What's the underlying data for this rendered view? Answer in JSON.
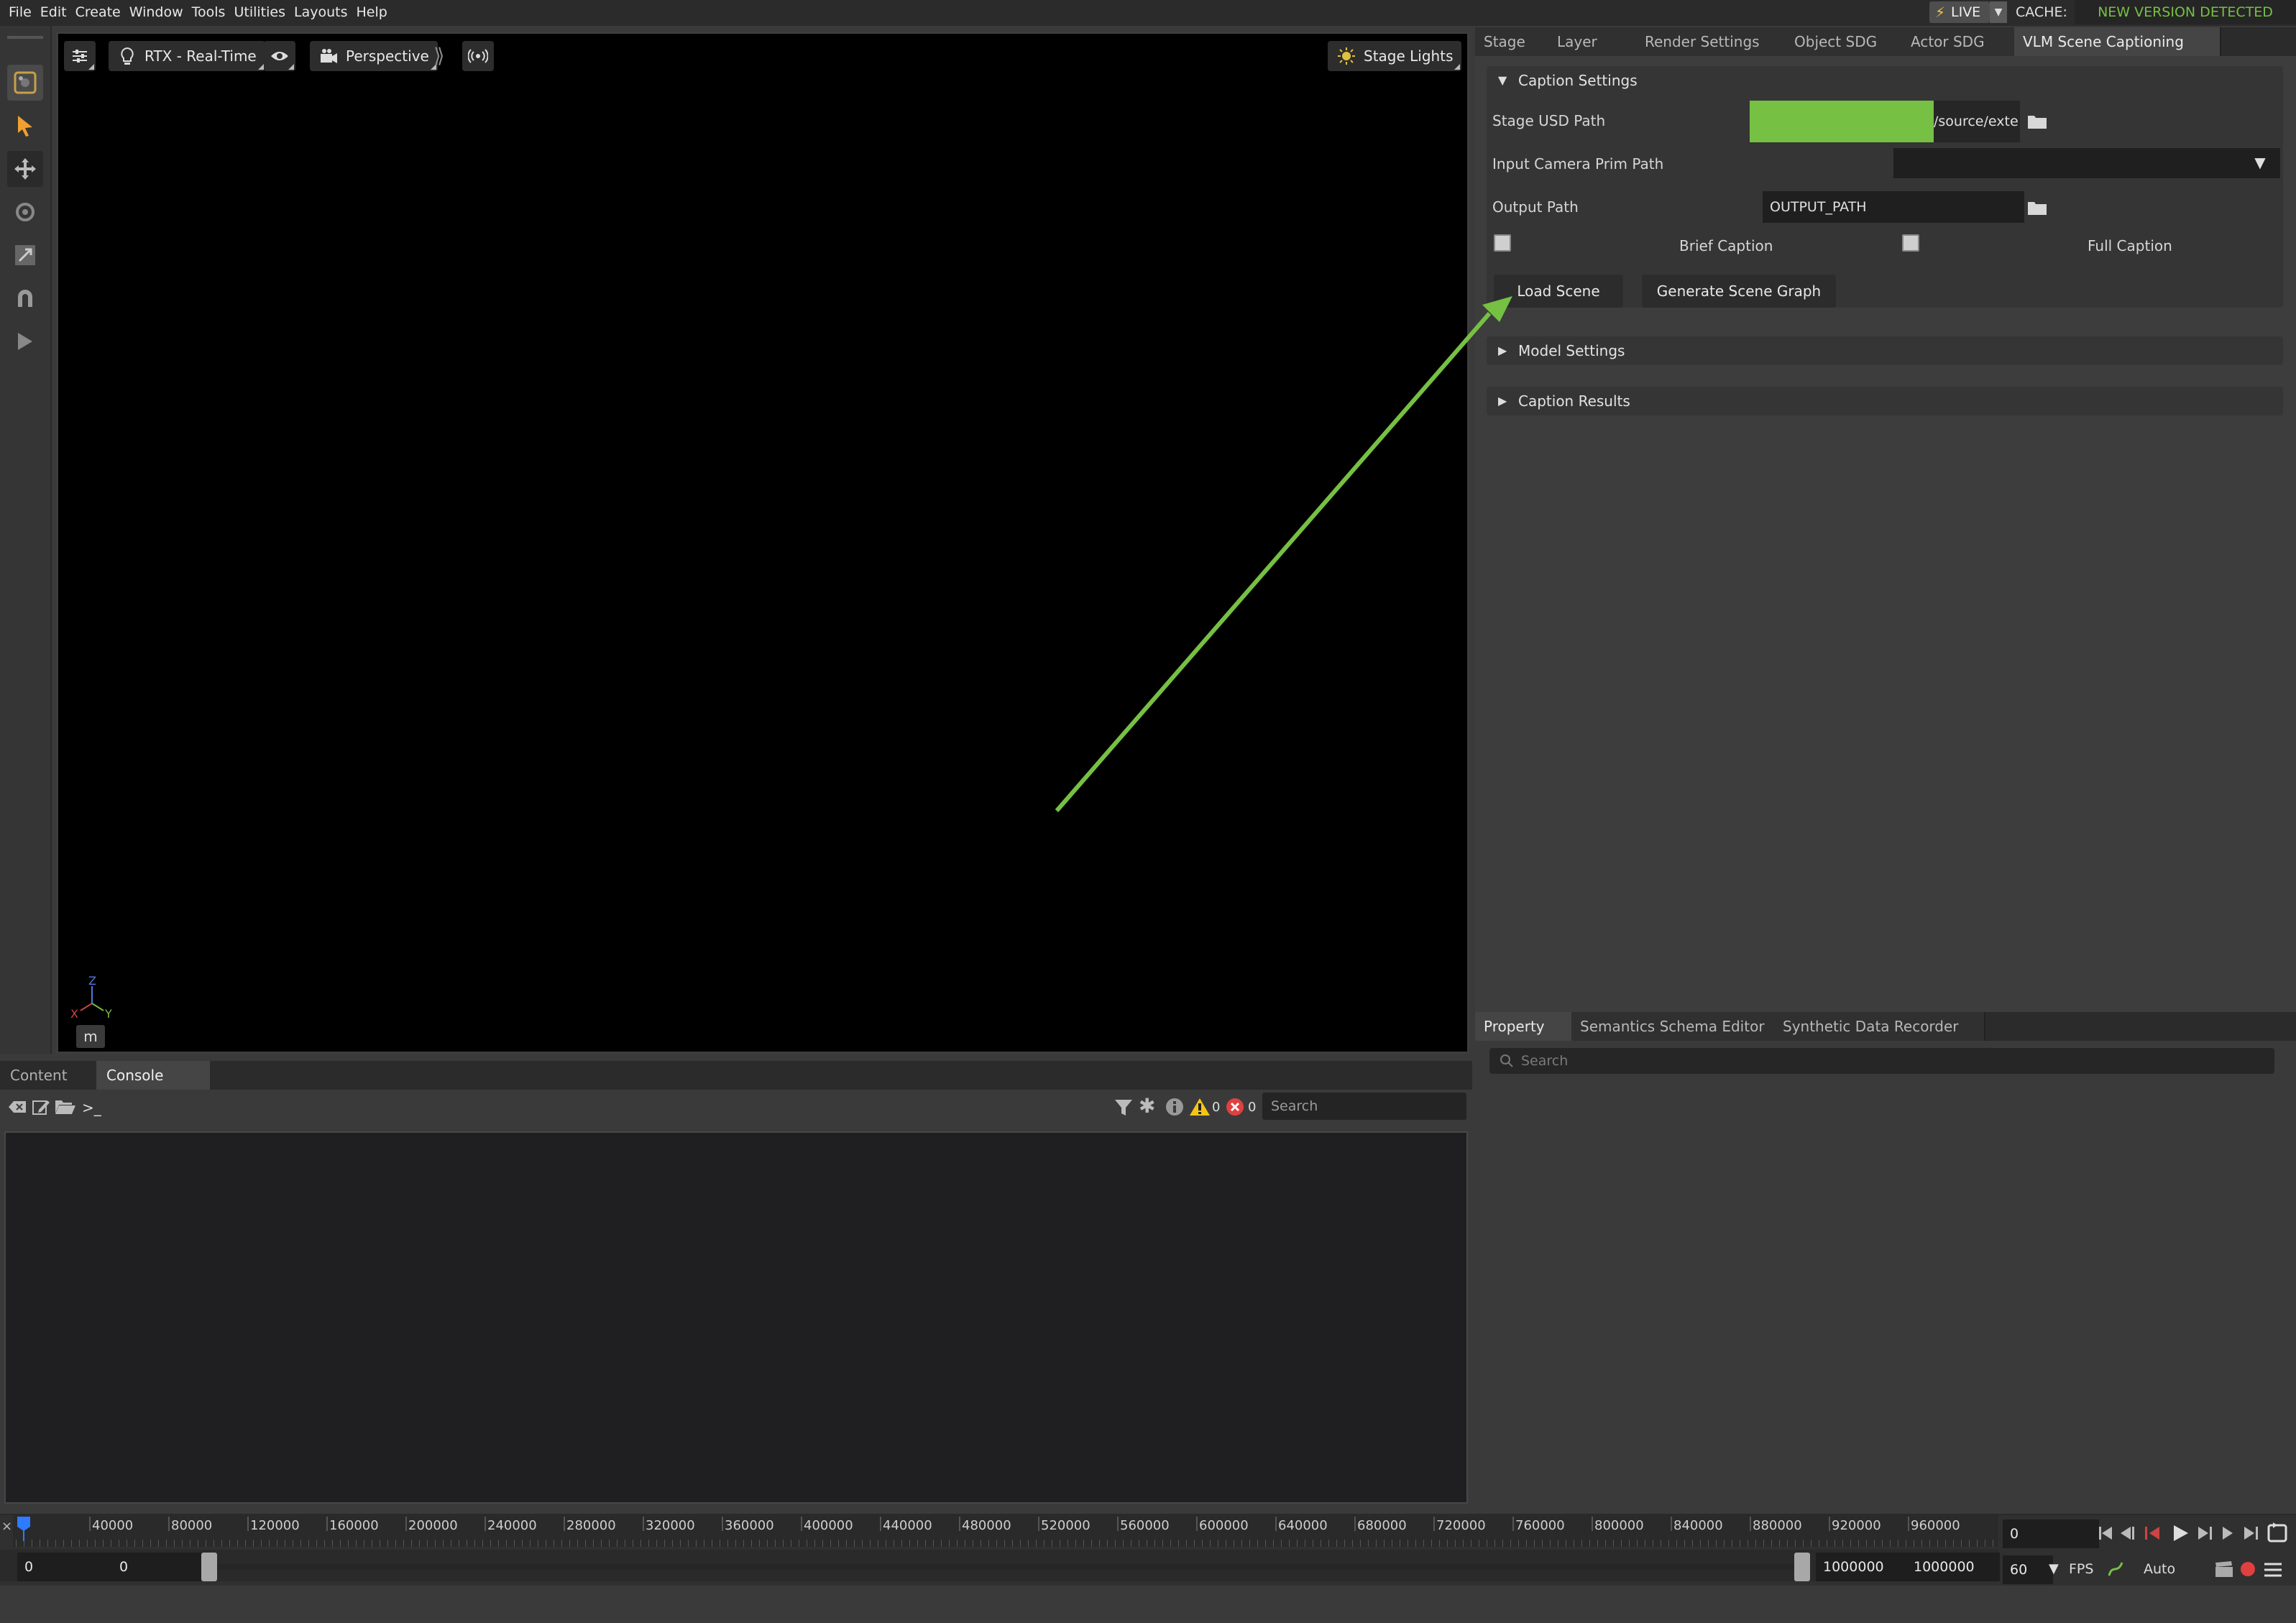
{
  "menu": {
    "items": [
      "File",
      "Edit",
      "Create",
      "Window",
      "Tools",
      "Utilities",
      "Layouts",
      "Help"
    ]
  },
  "header": {
    "live_label": "LIVE",
    "cache_label": "CACHE:",
    "cache_status": "NEW VERSION DETECTED"
  },
  "toolbar": {
    "tools": [
      "viewport-settings-icon",
      "select-icon",
      "move-icon",
      "rotate-icon",
      "scale-icon",
      "snap-icon",
      "play-icon"
    ]
  },
  "viewport": {
    "renderer_label": "RTX - Real-Time",
    "camera_label": "Perspective",
    "lights_label": "Stage Lights",
    "axis": {
      "z": "Z",
      "x": "X",
      "y": "Y"
    },
    "unit": "m"
  },
  "right_tabs": [
    "Stage",
    "Layer",
    "Render Settings",
    "Object SDG",
    "Actor SDG",
    "VLM Scene Captioning"
  ],
  "caption_settings": {
    "title": "Caption Settings",
    "stage_usd_label": "Stage USD Path",
    "stage_usd_value": "/source/exte",
    "camera_label": "Input Camera Prim Path",
    "camera_value": "",
    "output_label": "Output Path",
    "output_value": "OUTPUT_PATH",
    "brief_caption_label": "Brief Caption",
    "full_caption_label": "Full Caption",
    "load_scene_button": "Load Scene",
    "generate_graph_button": "Generate Scene Graph"
  },
  "model_settings": {
    "title": "Model Settings"
  },
  "caption_results": {
    "title": "Caption Results"
  },
  "property_tabs": [
    "Property",
    "Semantics Schema Editor",
    "Synthetic Data Recorder"
  ],
  "property": {
    "search_placeholder": "Search"
  },
  "bottom_tabs": [
    "Content",
    "Console"
  ],
  "console": {
    "warning_count": "0",
    "error_count": "0",
    "search_placeholder": "Search"
  },
  "timeline": {
    "ticks": [
      "40000",
      "80000",
      "120000",
      "160000",
      "200000",
      "240000",
      "280000",
      "320000",
      "360000",
      "400000",
      "440000",
      "480000",
      "520000",
      "560000",
      "600000",
      "640000",
      "680000",
      "720000",
      "760000",
      "800000",
      "840000",
      "880000",
      "920000",
      "960000"
    ],
    "current_frame": "0",
    "start": "0",
    "start_inner": "0",
    "end_inner": "1000000",
    "end": "1000000",
    "fps": "60",
    "fps_label": "FPS",
    "auto_label": "Auto"
  },
  "colors": {
    "accent_green": "#76c043",
    "highlight_green": "#76c043"
  }
}
